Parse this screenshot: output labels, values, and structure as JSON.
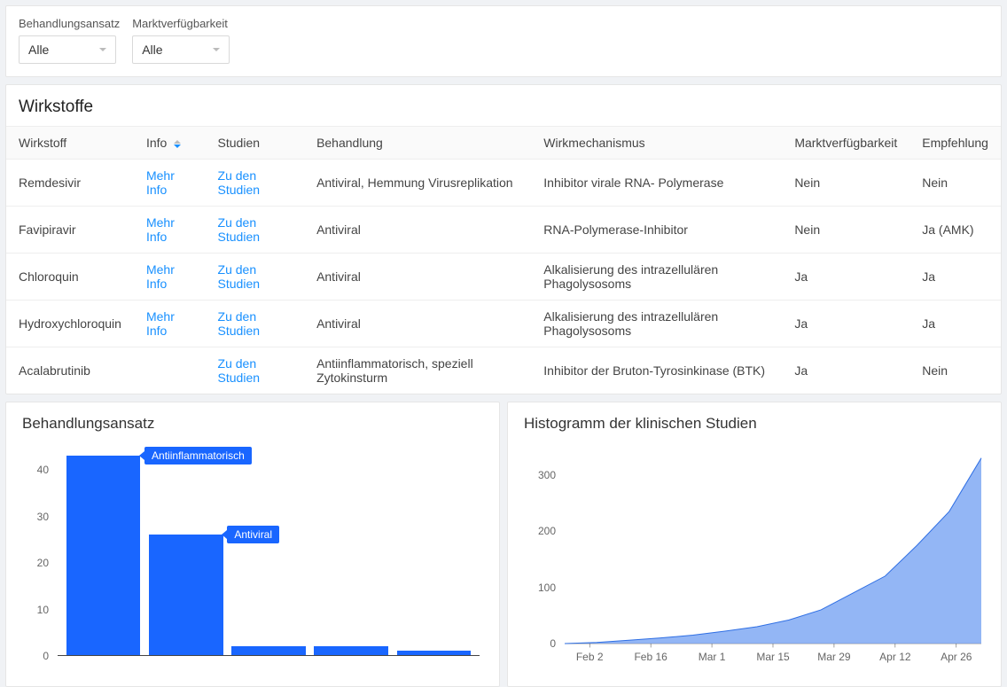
{
  "filters": {
    "treatment_label": "Behandlungsansatz",
    "treatment_value": "Alle",
    "availability_label": "Marktverfügbarkeit",
    "availability_value": "Alle"
  },
  "table": {
    "title": "Wirkstoffe",
    "columns": {
      "wirkstoff": "Wirkstoff",
      "info": "Info",
      "studien": "Studien",
      "behandlung": "Behandlung",
      "wirkmechanismus": "Wirkmechanismus",
      "marktverfugbarkeit": "Marktverfügbarkeit",
      "empfehlung": "Empfehlung"
    },
    "info_link_text": "Mehr Info",
    "studien_link_text": "Zu den Studien",
    "rows": [
      {
        "wirkstoff": "Remdesivir",
        "has_info": true,
        "behandlung": "Antiviral, Hemmung Virusreplikation",
        "wirkmechanismus": "Inhibitor virale RNA- Polymerase",
        "markt": "Nein",
        "empf": "Nein"
      },
      {
        "wirkstoff": "Favipiravir",
        "has_info": true,
        "behandlung": "Antiviral",
        "wirkmechanismus": "RNA-Polymerase-Inhibitor",
        "markt": "Nein",
        "empf": "Ja (AMK)"
      },
      {
        "wirkstoff": "Chloroquin",
        "has_info": true,
        "behandlung": "Antiviral",
        "wirkmechanismus": "Alkalisierung des intrazellulären Phagolysosoms",
        "markt": "Ja",
        "empf": "Ja"
      },
      {
        "wirkstoff": "Hydroxychloroquin",
        "has_info": true,
        "behandlung": "Antiviral",
        "wirkmechanismus": "Alkalisierung des intrazellulären Phagolysosoms",
        "markt": "Ja",
        "empf": "Ja"
      },
      {
        "wirkstoff": "Acalabrutinib",
        "has_info": false,
        "behandlung": "Antiinflammatorisch, speziell Zytokinsturm",
        "wirkmechanismus": "Inhibitor der Bruton-Tyrosinkinase (BTK)",
        "markt": "Ja",
        "empf": "Nein"
      }
    ]
  },
  "bar_chart_title": "Behandlungsansatz",
  "area_chart_title": "Histogramm der klinischen Studien",
  "bar_tooltip_0": "Antiinflammatorisch",
  "bar_tooltip_1": "Antiviral",
  "chart_data": [
    {
      "type": "bar",
      "title": "Behandlungsansatz",
      "categories": [
        "Antiinflammatorisch",
        "Antiviral",
        "",
        "",
        ""
      ],
      "values": [
        43,
        26,
        2,
        2,
        1
      ],
      "xlabel": "",
      "ylabel": "",
      "ylim": [
        0,
        45
      ],
      "y_ticks": [
        0,
        10,
        20,
        30,
        40
      ]
    },
    {
      "type": "area",
      "title": "Histogramm der klinischen Studien",
      "x_labels": [
        "Feb 2",
        "Feb 16",
        "Mar 1",
        "Mar 15",
        "Mar 29",
        "Apr 12",
        "Apr 26"
      ],
      "y_ticks": [
        0,
        100,
        200,
        300
      ],
      "ylim": [
        0,
        350
      ],
      "x": [
        0,
        1,
        2,
        3,
        4,
        5,
        6,
        7,
        8,
        9,
        10,
        11,
        12,
        13
      ],
      "values": [
        0,
        2,
        6,
        10,
        15,
        22,
        30,
        42,
        60,
        90,
        120,
        175,
        235,
        330
      ]
    }
  ]
}
